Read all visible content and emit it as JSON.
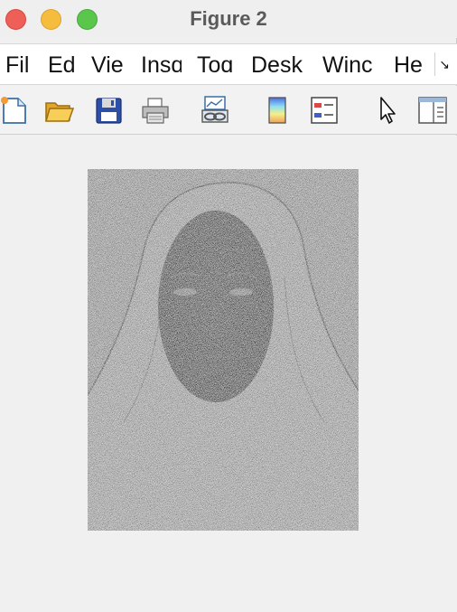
{
  "window": {
    "title": "Figure 2"
  },
  "menubar": {
    "items": [
      "Fil",
      "Ed",
      "Vie",
      "Insɑ",
      "Toɑ",
      "Desk",
      "Winc",
      "He"
    ],
    "overflow_icon": "chevron-overflow-icon"
  },
  "toolbar": {
    "tools": [
      {
        "name": "new-figure",
        "icon": "new-document-icon"
      },
      {
        "name": "open-file",
        "icon": "folder-open-icon"
      },
      {
        "name": "save-figure",
        "icon": "floppy-disk-icon"
      },
      {
        "name": "print-figure",
        "icon": "printer-icon"
      },
      {
        "name": "link-plot",
        "icon": "link-plot-icon"
      },
      {
        "name": "insert-colorbar",
        "icon": "colorbar-icon"
      },
      {
        "name": "insert-legend",
        "icon": "legend-icon"
      },
      {
        "name": "edit-plot",
        "icon": "pointer-arrow-icon"
      },
      {
        "name": "show-plot-tools",
        "icon": "plot-tools-panel-icon"
      }
    ]
  },
  "figure": {
    "content": "noisy grayscale image"
  }
}
